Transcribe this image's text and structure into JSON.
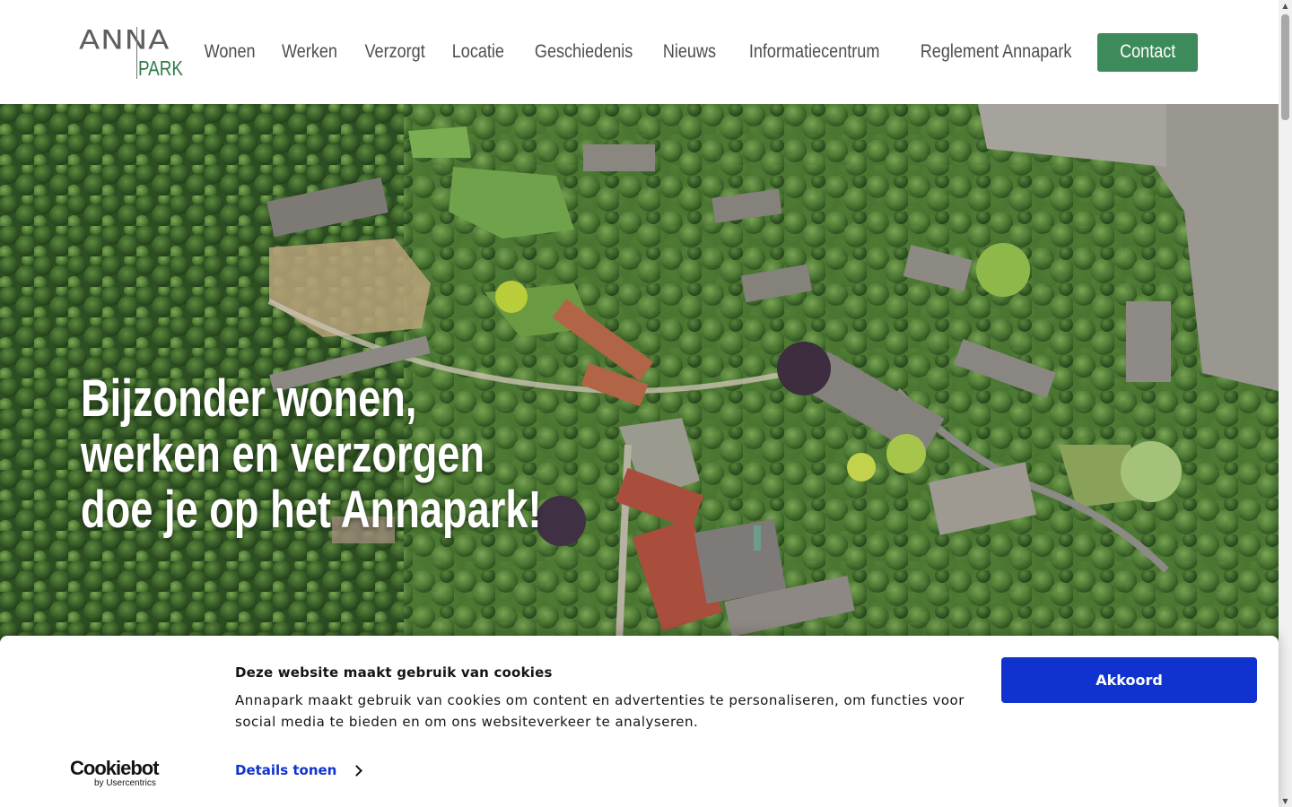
{
  "header": {
    "logo": {
      "top": "ANNA",
      "bottom": "PARK"
    },
    "nav": [
      "Wonen",
      "Werken",
      "Verzorgt",
      "Locatie",
      "Geschiedenis",
      "Nieuws",
      "Informatiecentrum",
      "Reglement Annapark"
    ],
    "contact_label": "Contact"
  },
  "hero": {
    "title_lines": [
      "Bijzonder wonen,",
      "werken en verzorgen",
      "doe je op het Annapark!"
    ],
    "image": "aerial-photo-park-estate"
  },
  "cookie_banner": {
    "title": "Deze website maakt gebruik van cookies",
    "text": "Annapark maakt gebruik van cookies om content en advertenties te personaliseren, om functies voor social media te bieden en om ons websiteverkeer te analyseren.",
    "details_label": "Details tonen",
    "accept_label": "Akkoord",
    "brand": "Cookiebot",
    "brand_sub": "by Usercentrics"
  },
  "colors": {
    "contact_button": "#3d8a5a",
    "cookie_accent": "#1032cf",
    "nav_text": "#4e4e4e"
  }
}
